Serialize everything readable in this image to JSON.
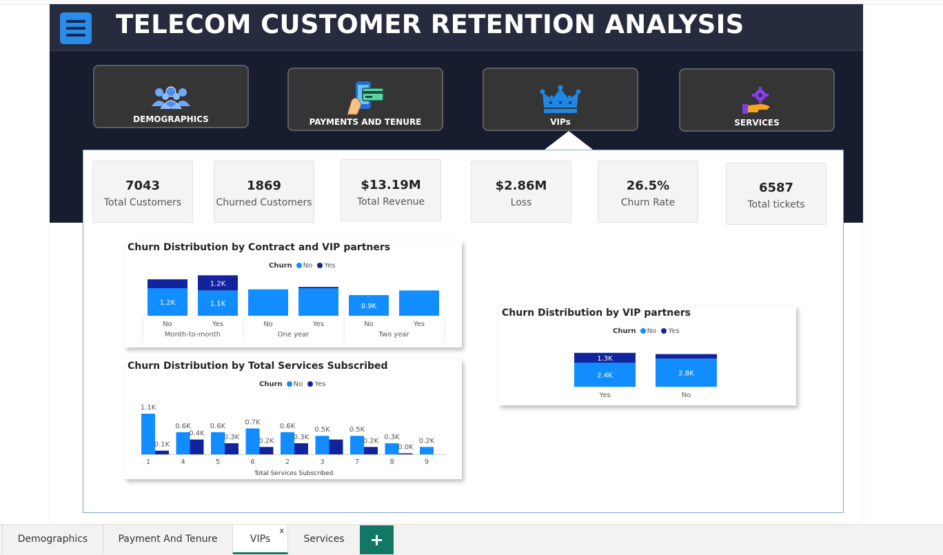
{
  "header": {
    "title": "TELECOM CUSTOMER RETENTION ANALYSIS"
  },
  "nav": [
    {
      "label": "DEMOGRAPHICS",
      "icon": "people-group-icon"
    },
    {
      "label": "PAYMENTS AND TENURE",
      "icon": "phone-payment-icon"
    },
    {
      "label": "VIPs",
      "icon": "crown-icon"
    },
    {
      "label": "SERVICES",
      "icon": "service-hand-gear-icon"
    }
  ],
  "kpis": [
    {
      "value": "7043",
      "label": "Total Customers"
    },
    {
      "value": "1869",
      "label": "Churned Customers"
    },
    {
      "value": "$13.19M",
      "label": "Total Revenue"
    },
    {
      "value": "$2.86M",
      "label": "Loss"
    },
    {
      "value": "26.5%",
      "label": "Churn Rate"
    },
    {
      "value": "6587",
      "label": "Total tickets"
    }
  ],
  "legend": {
    "title": "Churn",
    "no": "No",
    "yes": "Yes"
  },
  "colors": {
    "no": "#118dff",
    "yes": "#12239e",
    "accent": "#117865"
  },
  "chart_data": [
    {
      "type": "bar",
      "stacked": true,
      "title": "Churn Distribution by Contract and VIP partners",
      "groups": [
        "Month-to-month",
        "One year",
        "Two year"
      ],
      "categories": [
        "No",
        "Yes",
        "No",
        "Yes",
        "No",
        "Yes"
      ],
      "series": [
        {
          "name": "No",
          "values": [
            1200,
            1100,
            1150,
            1200,
            900,
            1100
          ],
          "labels": [
            "1.2K",
            "1.1K",
            "",
            "",
            "0.9K",
            ""
          ]
        },
        {
          "name": "Yes",
          "values": [
            700,
            1200,
            0,
            100,
            0,
            0
          ],
          "labels": [
            "",
            "1.2K",
            "",
            "",
            "",
            ""
          ]
        }
      ]
    },
    {
      "type": "bar",
      "title": "Churn Distribution by Total Services Subscribed",
      "xlabel": "Total Services Subscribed",
      "categories": [
        "1",
        "4",
        "5",
        "6",
        "2",
        "3",
        "7",
        "8",
        "9"
      ],
      "series": [
        {
          "name": "No",
          "values": [
            1100,
            600,
            600,
            700,
            600,
            500,
            500,
            300,
            200
          ],
          "labels": [
            "1.1K",
            "0.6K",
            "0.6K",
            "0.7K",
            "0.6K",
            "0.5K",
            "0.5K",
            "0.3K",
            "0.2K"
          ]
        },
        {
          "name": "Yes",
          "values": [
            100,
            400,
            300,
            200,
            300,
            400,
            200,
            0,
            0
          ],
          "labels": [
            "0.1K",
            "0.4K",
            "0.3K",
            "0.2K",
            "0.3K",
            "",
            "0.2K",
            "0.0K",
            ""
          ]
        }
      ]
    },
    {
      "type": "bar",
      "stacked": true,
      "title": "Churn Distribution by VIP partners",
      "categories": [
        "Yes",
        "No"
      ],
      "series": [
        {
          "name": "No",
          "values": [
            2400,
            2800
          ],
          "labels": [
            "2.4K",
            "2.8K"
          ]
        },
        {
          "name": "Yes",
          "values": [
            1300,
            600
          ],
          "labels": [
            "1.3K",
            ""
          ]
        }
      ]
    }
  ],
  "tabs": [
    {
      "label": "Demographics"
    },
    {
      "label": "Payment And Tenure"
    },
    {
      "label": "VIPs",
      "active": true,
      "close": "x"
    },
    {
      "label": "Services"
    }
  ],
  "add_tab": "+"
}
